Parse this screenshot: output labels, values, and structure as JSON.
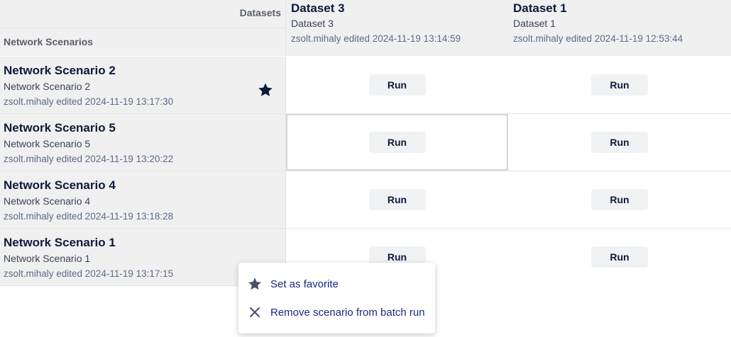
{
  "header": {
    "datasets_label": "Datasets",
    "scenarios_label": "Network Scenarios",
    "datasets": [
      {
        "title": "Dataset 3",
        "subtitle": "Dataset 3",
        "edited": "zsolt.mihaly edited 2024-11-19 13:14:59"
      },
      {
        "title": "Dataset 1",
        "subtitle": "Dataset 1",
        "edited": "zsolt.mihaly edited 2024-11-19 12:53:44"
      }
    ]
  },
  "rows": [
    {
      "title": "Network Scenario 2",
      "subtitle": "Network Scenario 2",
      "edited": "zsolt.mihaly edited 2024-11-19 13:17:30",
      "favorite": true
    },
    {
      "title": "Network Scenario 5",
      "subtitle": "Network Scenario 5",
      "edited": "zsolt.mihaly edited 2024-11-19 13:20:22",
      "favorite": false
    },
    {
      "title": "Network Scenario 4",
      "subtitle": "Network Scenario 4",
      "edited": "zsolt.mihaly edited 2024-11-19 13:18:28",
      "favorite": false
    },
    {
      "title": "Network Scenario 1",
      "subtitle": "Network Scenario 1",
      "edited": "zsolt.mihaly edited 2024-11-19 13:17:15",
      "favorite": false
    }
  ],
  "run_label": "Run",
  "context_menu": {
    "items": [
      {
        "label": "Set as favorite",
        "icon": "star-icon"
      },
      {
        "label": "Remove scenario from batch run",
        "icon": "close-icon"
      }
    ]
  },
  "colors": {
    "text_dark": "#0d1a3a",
    "menu_text": "#1a2a80",
    "header_bg": "#f0f0f0",
    "button_bg": "#f1f2f4"
  }
}
